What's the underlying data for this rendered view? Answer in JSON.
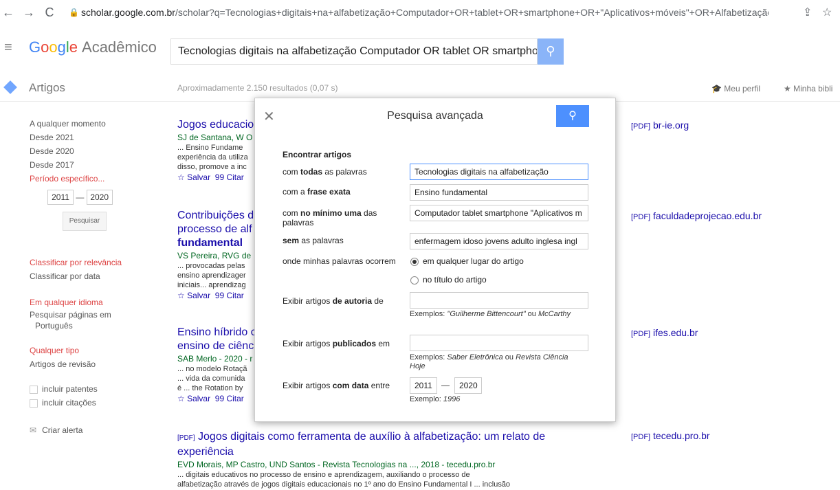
{
  "browser": {
    "url_host": "scholar.google.com.br",
    "url_path": "/scholar?q=Tecnologias+digitais+na+alfabetização+Computador+OR+tablet+OR+smartphone+OR+\"Aplicativos+móveis\"+OR+Alfabetização+OR+di..."
  },
  "header": {
    "logo_google": [
      "G",
      "o",
      "o",
      "g",
      "l",
      "e"
    ],
    "logo_product": "Acadêmico",
    "search_query": "Tecnologias digitais na alfabetização Computador OR tablet OR smartphone"
  },
  "subheader": {
    "section": "Artigos",
    "results_count": "Aproximadamente 2.150 resultados (0,07 s)",
    "my_profile": "Meu perfil",
    "my_library": "Minha bibli"
  },
  "sidebar": {
    "time": [
      "A qualquer momento",
      "Desde 2021",
      "Desde 2020",
      "Desde 2017"
    ],
    "custom_range": "Período específico...",
    "year_from": "2011",
    "year_to": "2020",
    "search_button": "Pesquisar",
    "sort_relevance": "Classificar por relevância",
    "sort_date": "Classificar por data",
    "any_language": "Em qualquer idioma",
    "search_pt": "Pesquisar páginas em",
    "search_pt_2": "Português",
    "any_type": "Qualquer tipo",
    "review_articles": "Artigos de revisão",
    "include_patents": "incluir patentes",
    "include_citations": "incluir citações",
    "create_alert": "Criar alerta"
  },
  "results": [
    {
      "title": "Jogos educacio",
      "authors": "SJ de Santana, W O",
      "snippet": [
        "... Ensino Fundame",
        "experiência da utiliza",
        "disso, promove a inc"
      ],
      "save": "☆ Salvar",
      "cite": "99 Citar",
      "pdf": "br-ie.org"
    },
    {
      "title_1": "Contribuições d",
      "title_2": "processo de alf",
      "title_3": "fundamental",
      "authors": "VS Pereira, RVG de",
      "snippet": [
        "... provocadas pelas",
        "ensino aprendizager",
        "iniciais... aprendizag"
      ],
      "save": "☆ Salvar",
      "cite": "99 Citar",
      "pdf": "faculdadeprojecao.edu.br"
    },
    {
      "title_1": "Ensino híbrido c",
      "title_2": "ensino de ciênc",
      "authors": "SAB Merlo - 2020 - r",
      "snippet": [
        "... no modelo Rotaçã",
        "... vida da comunida",
        "é ... the Rotation by"
      ],
      "save": "☆ Salvar",
      "cite": "99 Citar",
      "pdf": "ifes.edu.br"
    },
    {
      "title_prefix": "[PDF]",
      "title": "Jogos digitais como ferramenta de auxílio à alfabetização: um relato de",
      "title_2": "experiência",
      "authors": "EVD Morais, MP Castro, UND Santos - Revista Tecnologias na ..., 2018 - tecedu.pro.br",
      "snippet": [
        "... digitais educativos no processo de ensino e aprendizagem, auxiliando o processo de",
        "alfabetização através de jogos digitais educacionais no 1º ano do Ensino Fundamental I ... inclusão"
      ],
      "pdf": "tecedu.pro.br"
    }
  ],
  "pdf_tag": "[PDF]",
  "dialog": {
    "title": "Pesquisa avançada",
    "section": "Encontrar artigos",
    "all_words_label_pre": "com ",
    "all_words_label_bold": "todas",
    "all_words_label_post": " as palavras",
    "all_words_value": "Tecnologias digitais na alfabetização",
    "exact_label_pre": "com a ",
    "exact_label_bold": "frase exata",
    "exact_value": "Ensino fundamental",
    "atleast_label_pre": "com ",
    "atleast_label_bold": "no mínimo uma",
    "atleast_label_post": " das palavras",
    "atleast_value": "Computador tablet smartphone \"Aplicativos m",
    "without_label_bold": "sem",
    "without_label_post": " as palavras",
    "without_value": "enfermagem idoso jovens adulto inglesa ingl",
    "where_label": "onde minhas palavras ocorrem",
    "where_opt1": "em qualquer lugar do artigo",
    "where_opt2": "no título do artigo",
    "author_label_pre": "Exibir artigos ",
    "author_label_bold": "de autoria",
    "author_label_post": " de",
    "author_value": "",
    "author_example_pre": "Exemplos: ",
    "author_example_em": "\"Guilherme Bittencourt\"",
    "author_example_mid": " ou ",
    "author_example_em2": "McCarthy",
    "pub_label_pre": "Exibir artigos ",
    "pub_label_bold": "publicados",
    "pub_label_post": " em",
    "pub_value": "",
    "pub_example_pre": "Exemplos: ",
    "pub_example_em": "Saber Eletrônica",
    "pub_example_mid": " ou ",
    "pub_example_em2": "Revista Ciência Hoje",
    "date_label_pre": "Exibir artigos ",
    "date_label_bold": "com data",
    "date_label_post": " entre",
    "date_from": "2011",
    "date_to": "2020",
    "date_example_pre": "Exemplo: ",
    "date_example_em": "1996"
  }
}
